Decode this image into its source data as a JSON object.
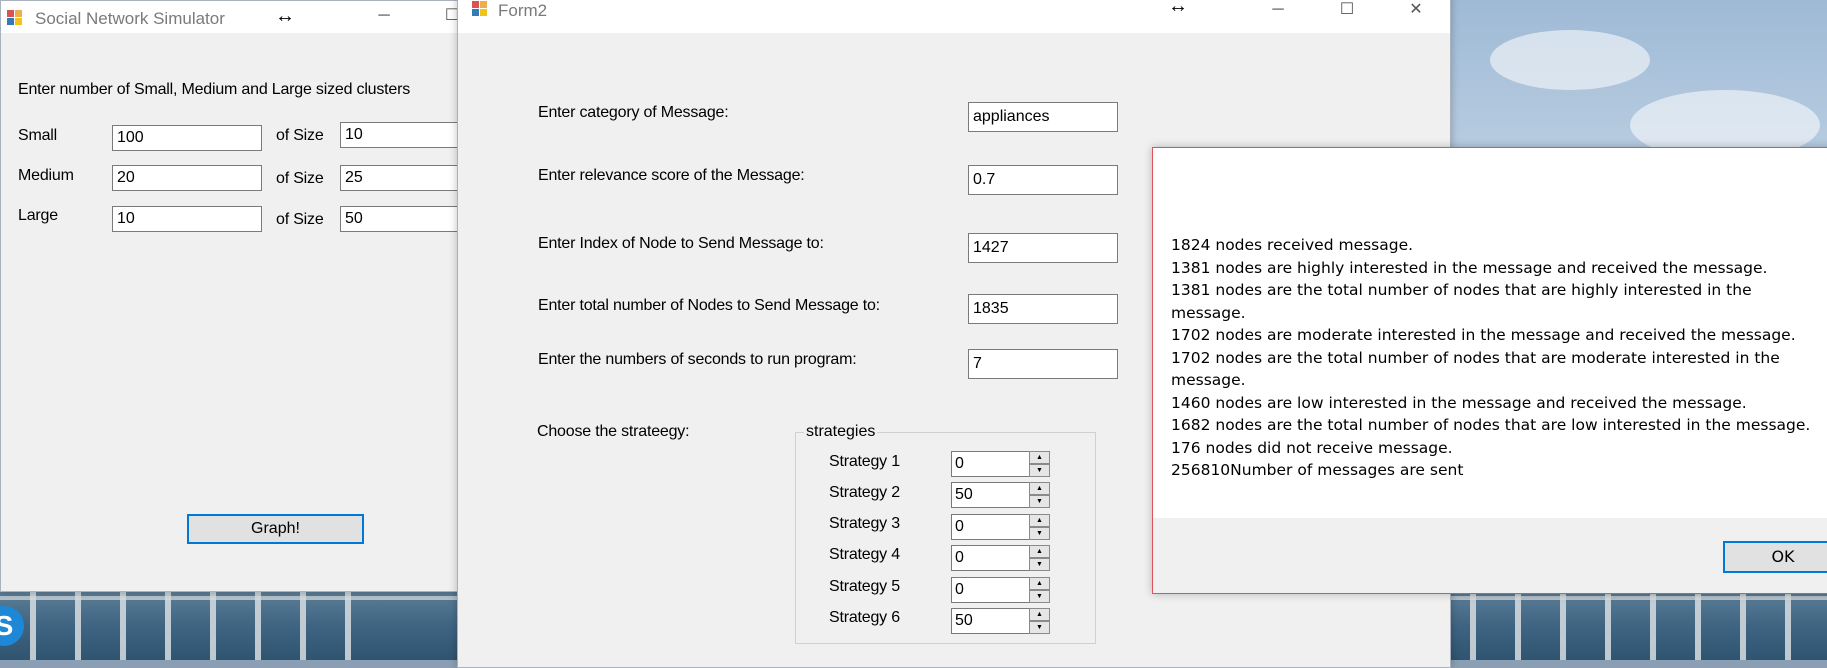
{
  "window1": {
    "title": "Social Network Simulator",
    "resize_glyph": "↔",
    "prompt": "Enter number of Small, Medium and Large sized clusters",
    "rows": [
      {
        "label": "Small",
        "count": "100",
        "size_label": "of Size",
        "size": "10"
      },
      {
        "label": "Medium",
        "count": "20",
        "size_label": "of Size",
        "size": "25"
      },
      {
        "label": "Large",
        "count": "10",
        "size_label": "of Size",
        "size": "50"
      }
    ],
    "graph_button": "Graph!"
  },
  "window2": {
    "title": "Form2",
    "resize_glyph": "↔",
    "fields": [
      {
        "label": "Enter category of Message:",
        "value": "appliances"
      },
      {
        "label": "Enter relevance score of the Message:",
        "value": "0.7"
      },
      {
        "label": "Enter Index of Node to Send Message to:",
        "value": "1427"
      },
      {
        "label": "Enter total number of Nodes to Send Message to:",
        "value": "1835"
      },
      {
        "label": "Enter the numbers of seconds to run program:",
        "value": "7"
      }
    ],
    "strategy_prompt": "Choose the strateegy:",
    "strategies_group_title": "strategies",
    "strategies": [
      {
        "label": "Strategy 1",
        "value": "0"
      },
      {
        "label": "Strategy 2",
        "value": "50"
      },
      {
        "label": "Strategy 3",
        "value": "0"
      },
      {
        "label": "Strategy 4",
        "value": "0"
      },
      {
        "label": "Strategy 5",
        "value": "0"
      },
      {
        "label": "Strategy 6",
        "value": "50"
      }
    ]
  },
  "message_box": {
    "lines": [
      "1824 nodes received message.",
      "1381 nodes are highly interested in the message and received the message.",
      "1381 nodes are the total number of nodes that are highly interested in the",
      "message.",
      "1702 nodes are moderate interested in the message and received the message.",
      "1702 nodes are the total number of nodes that are moderate interested in the",
      "message.",
      "1460 nodes are low interested in the message and received the message.",
      "1682 nodes are the total number of nodes that are low interested in the message.",
      "176 nodes did not receive message.",
      "256810Number of messages are sent"
    ],
    "ok_button": "OK"
  },
  "icons": {
    "minimize": "minimize-icon",
    "maximize": "maximize-icon",
    "close": "close-icon",
    "app": "winforms-app-icon"
  },
  "colors": {
    "focus_border": "#0078d7",
    "dialog_border": "#e0525a"
  }
}
